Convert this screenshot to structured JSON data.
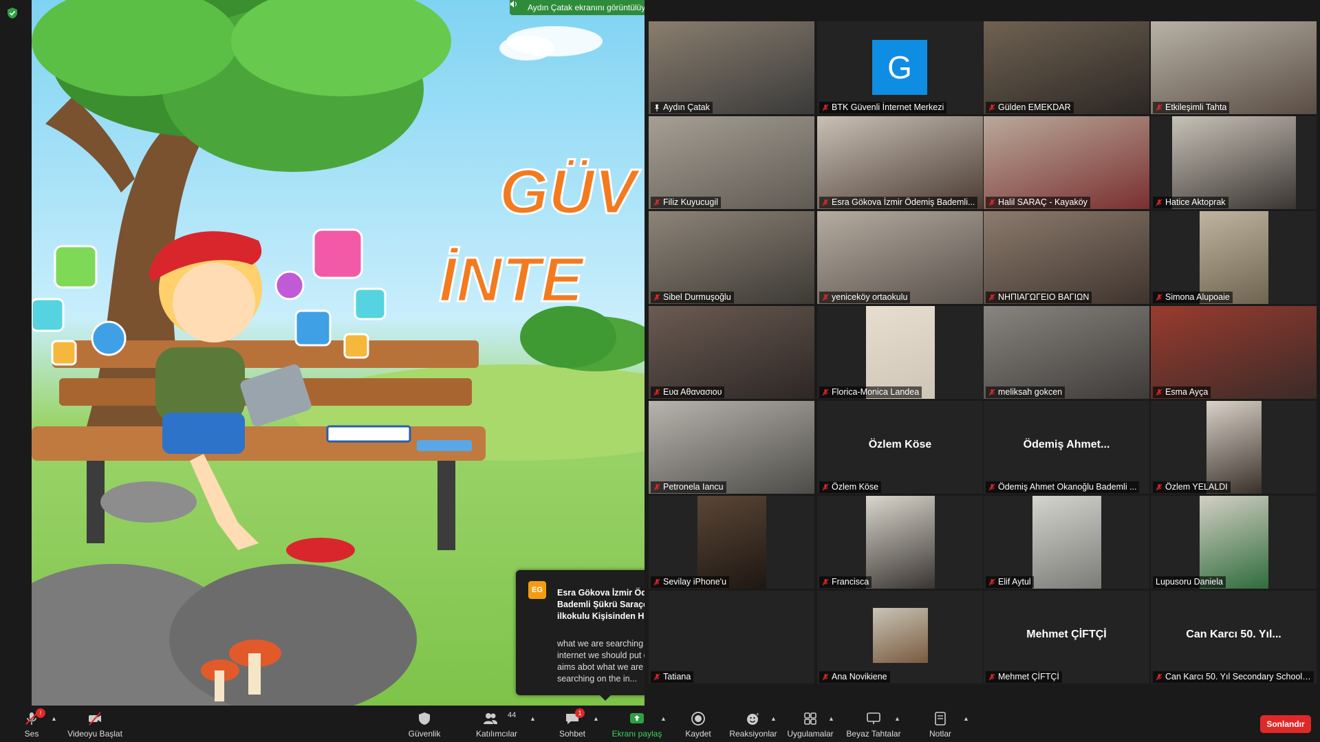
{
  "sharing_banner": "Aydın Çatak ekranını görüntülüyorsunuz",
  "slide": {
    "title_line1": "GÜV",
    "title_line2": "İNTE"
  },
  "chat_toast": {
    "initials": "EG",
    "sender": "Esra Gökova İzmir Ödemiş Bademli Şükrü Saraçoğlu ilkokulu Kişisinden Herkese",
    "message": "what we are searching on the internet we should put our aims abot what we are searching on the in..."
  },
  "participants": [
    {
      "name": "Aydın Çatak",
      "big": "",
      "muted": false,
      "pinned": true,
      "video": "v1"
    },
    {
      "name": "BTK Güvenli İnternet Merkezi",
      "big": "",
      "muted": true,
      "avatar": "G",
      "video": "none"
    },
    {
      "name": "Gülden EMEKDAR",
      "big": "",
      "muted": true,
      "video": "v2"
    },
    {
      "name": "Etkileşimli Tahta",
      "big": "",
      "muted": true,
      "video": "v3"
    },
    {
      "name": "Filiz Kuyucugil",
      "big": "",
      "muted": true,
      "video": "v4"
    },
    {
      "name": "Esra Gökova İzmir Ödemiş Bademli...",
      "big": "",
      "muted": true,
      "video": "v5"
    },
    {
      "name": "Halil SARAÇ - Kayaköy",
      "big": "",
      "muted": true,
      "video": "v6"
    },
    {
      "name": "Hatice Aktoprak",
      "big": "",
      "muted": true,
      "video": "v7n"
    },
    {
      "name": "Sibel Durmuşoğlu",
      "big": "",
      "muted": true,
      "video": "v8"
    },
    {
      "name": "yeniceköy ortaokulu",
      "big": "",
      "muted": true,
      "video": "v9"
    },
    {
      "name": "ΝΗΠΙΑΓΩΓΕΙΟ ΒΑΓΙΩΝ",
      "big": "",
      "muted": true,
      "video": "v10"
    },
    {
      "name": "Simona Alupoaie",
      "big": "",
      "muted": true,
      "video": "v11n"
    },
    {
      "name": "Ευα Αθανασιου",
      "big": "",
      "muted": true,
      "video": "v12"
    },
    {
      "name": "Florica-Monica Landea",
      "big": "",
      "muted": true,
      "video": "v13n"
    },
    {
      "name": "meliksah gokcen",
      "big": "",
      "muted": true,
      "video": "v14"
    },
    {
      "name": "Esma Ayça",
      "big": "",
      "muted": true,
      "video": "v15"
    },
    {
      "name": "Petronela Iancu",
      "big": "",
      "muted": true,
      "video": "v16"
    },
    {
      "name": "Özlem Köse",
      "big": "Özlem Köse",
      "muted": true,
      "video": "none"
    },
    {
      "name": "Ödemiş Ahmet Okanoğlu Bademli ...",
      "big": "Ödemiş Ahmet...",
      "muted": true,
      "video": "none"
    },
    {
      "name": "Özlem YELALDI",
      "big": "",
      "muted": true,
      "video": "v17n"
    },
    {
      "name": "Sevilay iPhone'u",
      "big": "",
      "muted": true,
      "video": "v18n"
    },
    {
      "name": "Francisca",
      "big": "",
      "muted": true,
      "video": "v19n"
    },
    {
      "name": "Elif Aytul",
      "big": "",
      "muted": true,
      "video": "v20n"
    },
    {
      "name": "Lupusoru Daniela",
      "big": "",
      "muted": false,
      "video": "v21n"
    },
    {
      "name": "Tatiana",
      "big": "",
      "muted": true,
      "video": "none"
    },
    {
      "name": "Ana Novikiene",
      "big": "",
      "muted": true,
      "video": "v22s"
    },
    {
      "name": "Mehmet ÇİFTÇİ",
      "big": "Mehmet ÇİFTÇİ",
      "muted": true,
      "video": "none"
    },
    {
      "name": "Can Karcı 50. Yıl Secondary School ...",
      "big": "Can Karcı 50. Yıl...",
      "muted": true,
      "video": "none"
    }
  ],
  "toolbar": {
    "audio": "Ses",
    "video": "Videoyu Başlat",
    "security": "Güvenlik",
    "participants": "Katılımcılar",
    "participants_count": "44",
    "chat": "Sohbet",
    "chat_badge": "1",
    "audio_badge": "!",
    "share": "Ekranı paylaş",
    "record": "Kaydet",
    "reactions": "Reaksiyonlar",
    "apps": "Uygulamalar",
    "whiteboard": "Beyaz Tahtalar",
    "notes": "Notlar",
    "end": "Sonlandır"
  },
  "colors": {
    "share_green": "#2e8b3a",
    "end_red": "#e02828",
    "active_outline": "#e8d98b",
    "avatar_blue": "#0e8de3"
  }
}
